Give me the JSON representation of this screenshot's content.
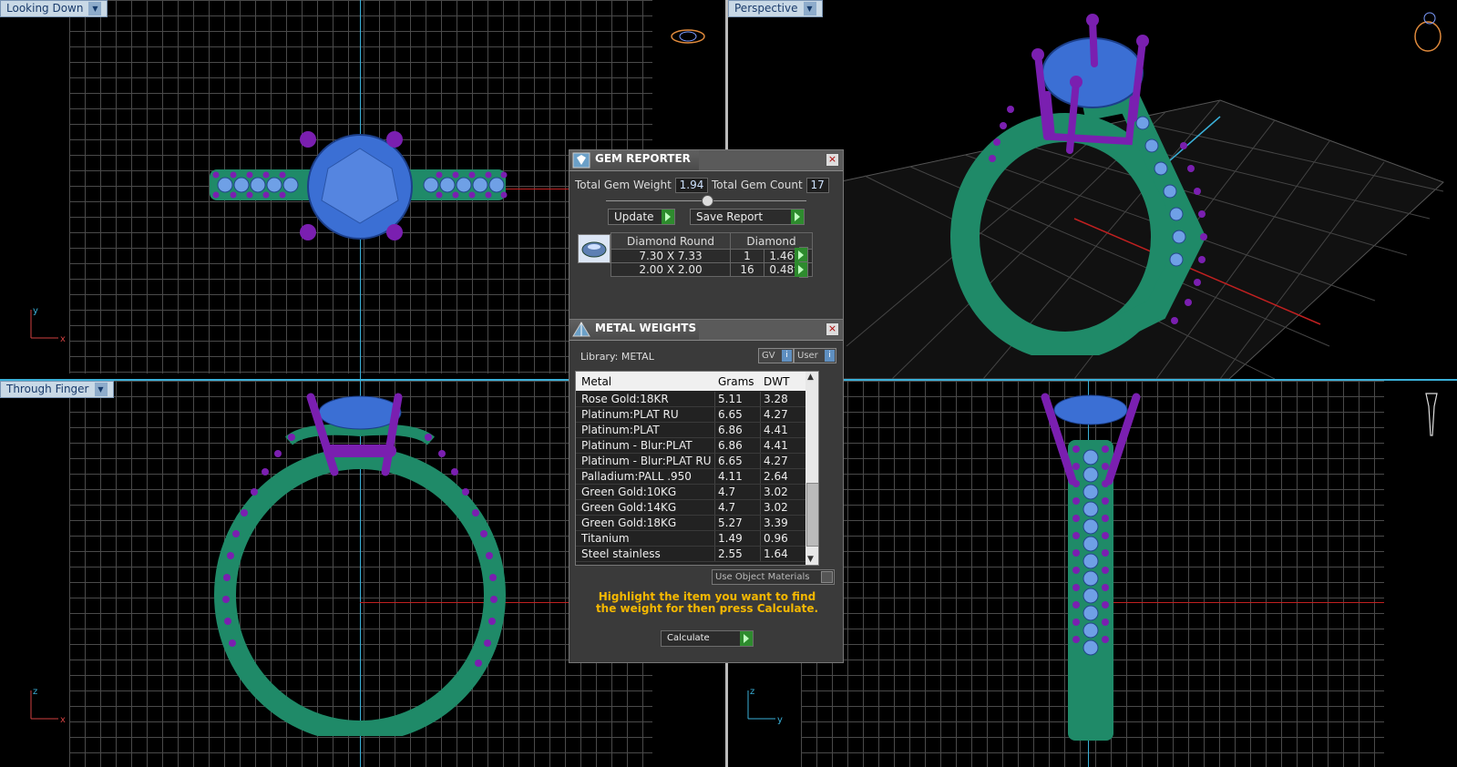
{
  "viewports": {
    "top_left": {
      "label": "Looking Down",
      "axis_h": "x",
      "axis_v": "y"
    },
    "top_right": {
      "label": "Perspective"
    },
    "bottom_left": {
      "label": "Through Finger",
      "axis_h": "x",
      "axis_v": "z"
    },
    "bottom_right": {
      "axis_h": "y",
      "axis_v": "z"
    }
  },
  "gem_reporter": {
    "title": "GEM REPORTER",
    "total_gem_weight_label": "Total Gem Weight",
    "total_gem_weight": "1.94",
    "total_gem_count_label": "Total Gem Count",
    "total_gem_count": "17",
    "update_label": "Update",
    "save_report_label": "Save Report",
    "gem_shape": "Diamond Round",
    "gem_type": "Diamond",
    "rows": [
      {
        "size": "7.30 X 7.33",
        "count": "1",
        "weight": "1.46tw"
      },
      {
        "size": "2.00 X 2.00",
        "count": "16",
        "weight": "0.48tw"
      }
    ]
  },
  "metal_weights": {
    "title": "METAL WEIGHTS",
    "library_label": "Library: METAL",
    "gv_label": "GV",
    "user_label": "User",
    "columns": [
      "Metal",
      "Grams",
      "DWT"
    ],
    "rows": [
      {
        "metal": "Rose Gold:18KR",
        "grams": "5.11",
        "dwt": "3.28"
      },
      {
        "metal": "Platinum:PLAT RU",
        "grams": "6.65",
        "dwt": "4.27"
      },
      {
        "metal": "Platinum:PLAT",
        "grams": "6.86",
        "dwt": "4.41"
      },
      {
        "metal": "Platinum - Blur:PLAT",
        "grams": "6.86",
        "dwt": "4.41"
      },
      {
        "metal": "Platinum - Blur:PLAT RU",
        "grams": "6.65",
        "dwt": "4.27"
      },
      {
        "metal": "Palladium:PALL .950",
        "grams": "4.11",
        "dwt": "2.64"
      },
      {
        "metal": "Green Gold:10KG",
        "grams": "4.7",
        "dwt": "3.02"
      },
      {
        "metal": "Green Gold:14KG",
        "grams": "4.7",
        "dwt": "3.02"
      },
      {
        "metal": "Green Gold:18KG",
        "grams": "5.27",
        "dwt": "3.39"
      },
      {
        "metal": "Titanium",
        "grams": "1.49",
        "dwt": "0.96"
      },
      {
        "metal": "Steel stainless",
        "grams": "2.55",
        "dwt": "1.64"
      }
    ],
    "use_object_materials_label": "Use Object Materials",
    "hint_text": "Highlight the item you want to find the weight for then press Calculate.",
    "calculate_label": "Calculate"
  },
  "colors": {
    "metal": "#1f8a68",
    "prong": "#7a1fb0",
    "gem": "#3b6fd4",
    "hint": "#f5b800"
  }
}
